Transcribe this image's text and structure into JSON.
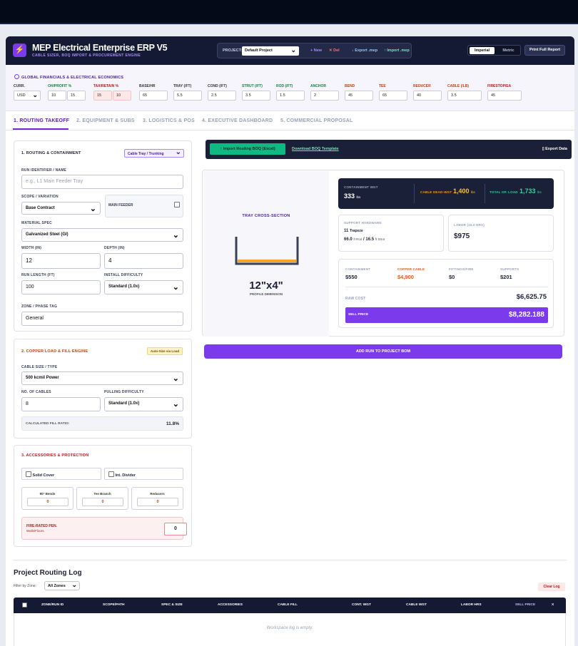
{
  "header": {
    "title": "MEP Electrical Enterprise ERP V5",
    "subtitle": "CABLE SIZER, BOQ IMPORT & PROCUREMENT ENGINE",
    "project_label": "PROJECT:",
    "project_value": "Default Project",
    "new_label": "+ New",
    "del_label": "✕ Del",
    "export_label": "↓ Export .mep",
    "import_label": "↑ Import .mep",
    "unit_imperial": "Imperial",
    "unit_metric": "Metric",
    "print_label": "Print Full Report"
  },
  "financials": {
    "title": "GLOBAL FINANCIALS & ELECTRICAL ECONOMICS",
    "curr_label": "CURR.",
    "curr_value": "USD",
    "ohprofit_label": "OH/PROFIT %",
    "oh_value": "10",
    "profit_value": "15",
    "taxretain_label": "TAX/RETAIN %",
    "tax_value": "15",
    "retain_value": "10",
    "basehr_label": "BASE/HR",
    "basehr_value": "65",
    "tray_label": "TRAY (/FT)",
    "tray_value": "5.5",
    "cond_label": "COND (/FT)",
    "cond_value": "2.5",
    "strut_label": "STRUT (/FT)",
    "strut_value": "3.5",
    "rod_label": "ROD (/FT)",
    "rod_value": "1.5",
    "anchor_label": "ANCHOR",
    "anchor_value": "2",
    "bend_label": "BEND",
    "bend_value": "45",
    "tee_label": "TEE",
    "tee_value": "65",
    "reducer_label": "REDUCER",
    "reducer_value": "40",
    "cable_label": "CABLE (/LB)",
    "cable_value": "3.5",
    "firestop_label": "FIRESTOP/EA",
    "firestop_value": "45"
  },
  "tabs": [
    {
      "label": "1. ROUTING TAKEOFF"
    },
    {
      "label": "2. EQUIPMENT & SUBS"
    },
    {
      "label": "3. LOGISTICS & POS"
    },
    {
      "label": "4. EXECUTIVE DASHBOARD"
    },
    {
      "label": "5. COMMERCIAL PROPOSAL"
    }
  ],
  "routing": {
    "title": "1. ROUTING & CONTAINMENT",
    "mode": "Cable Tray / Trunking",
    "run_id_label": "RUN IDENTIFIER / NAME",
    "run_id_placeholder": "e.g., L1 Main Feeder Tray",
    "scope_label": "SCOPE / VARIATION",
    "scope_value": "Base Contract",
    "main_feeder_label": "MAIN FEEDER",
    "material_label": "MATERIAL SPEC",
    "material_value": "Galvanized Steel (GI)",
    "width_label": "WIDTH (IN)",
    "width_value": "12",
    "depth_label": "DEPTH (IN)",
    "depth_value": "4",
    "length_label": "RUN LENGTH (FT)",
    "length_value": "100",
    "difficulty_label": "INSTALL DIFFICULTY",
    "difficulty_value": "Standard (1.0x)",
    "zone_label": "ZONE / PHASE TAG",
    "zone_value": "General"
  },
  "copper": {
    "title": "2. COPPER LOAD & FILL ENGINE",
    "autosize": "Auto-Size via Load",
    "size_label": "CABLE SIZE / TYPE",
    "size_value": "500 kcmil Power",
    "count_label": "NO. OF CABLES",
    "count_value": "8",
    "pulling_label": "PULLING DIFFICULTY",
    "pulling_value": "Standard (1.0x)",
    "fill_label": "CALCULATED FILL RATIO:",
    "fill_value": "11.8%"
  },
  "accessories": {
    "title": "3. ACCESSORIES & PROTECTION",
    "solid_cover": "Solid Cover",
    "int_divider": "Int. Divider",
    "bends_label": "90° Bends",
    "bends_value": "0",
    "tee_label": "Tee Branch",
    "tee_value": "0",
    "reducers_label": "Reducers",
    "reducers_value": "0",
    "fire_label": "FIRE-RATED PEN.",
    "fire_sub": "Walls/Floors",
    "fire_value": "0"
  },
  "import": {
    "import_btn": "↑ Import Routing BOQ (Excel)",
    "template_link": "Download BOQ Template",
    "export_data": "Export Data"
  },
  "viz": {
    "cross_title": "TRAY CROSS-SECTION",
    "dimension": "12\"x4\"",
    "dimension_sub": "PROFILE DIMENSION",
    "containment_label": "CONTAINMENT WGT",
    "containment_value": "333",
    "containment_unit": "lbs",
    "cable_dead_label": "CABLE DEAD-WGT",
    "cable_dead_value": "1,400",
    "cable_dead_unit": "lbs",
    "total_load_label": "TOTAL OP. LOAD",
    "total_load_value": "1,733",
    "total_load_unit": "lbs",
    "support_label": "SUPPORT HARDWARE",
    "support_count": "11",
    "support_type": "Trapeze",
    "rod_value": "66.0",
    "rod_unit": "ft Rod",
    "sep": "/",
    "strut_value": "16.5",
    "strut_unit": "ft Strut",
    "labor_label": "LABOR (15.0 HRS)",
    "labor_value": "$975",
    "containment_cost_label": "CONTAINMENT",
    "containment_cost": "$550",
    "copper_cost_label": "COPPER CABLE",
    "copper_cost": "$4,900",
    "fittings_label": "FITTINGS/FIRE",
    "fittings_cost": "$0",
    "supports_label": "SUPPORTS",
    "supports_cost": "$201",
    "raw_label": "RAW COST",
    "raw_value": "$6,625.75",
    "sell_label": "SELL PRICE",
    "sell_value": "$8,282.188"
  },
  "add_run": "ADD RUN TO PROJECT BOM",
  "log": {
    "title": "Project Routing Log",
    "filter_label": "Filter by Zone:",
    "filter_value": "All Zones",
    "clear_label": "Clear Log",
    "columns": [
      "ZONE/RUN ID",
      "SCOPE/PATH",
      "SPEC & SIZE",
      "ACCESSORIES",
      "CABLE FILL",
      "CONT. WGT",
      "CABLE WGT",
      "LABOR HRS",
      "SELL PRICE",
      "X"
    ],
    "empty": "Workspace log is empty."
  },
  "colors": {
    "accent": "#7c3aed",
    "header_bg": "#141a33",
    "green": "#10b981",
    "orange": "#c2410c",
    "tray_fill": "#f5a623"
  }
}
